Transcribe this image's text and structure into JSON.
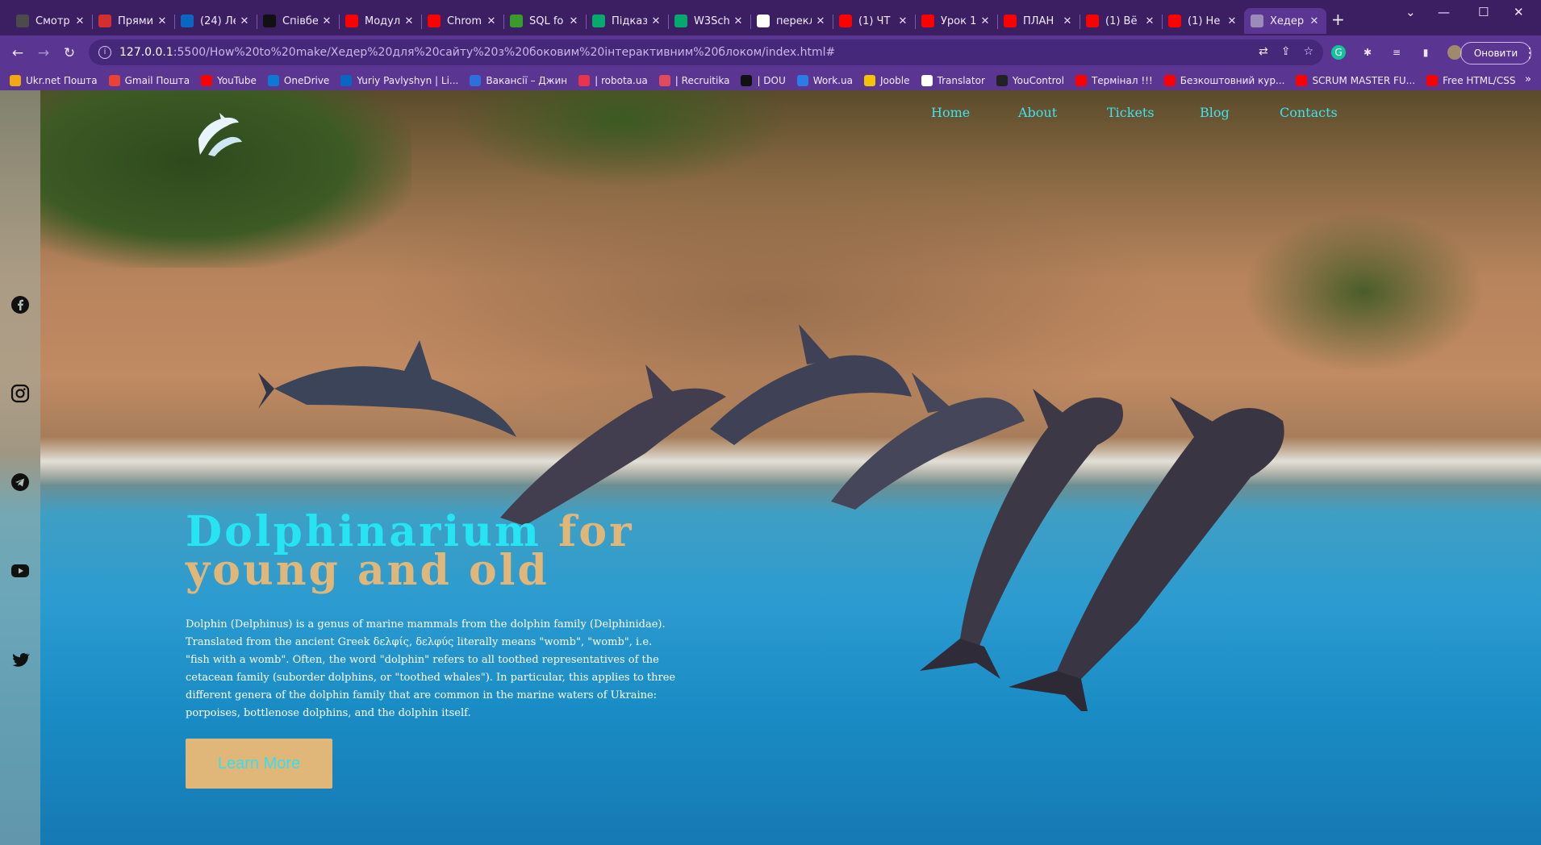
{
  "tabs": [
    {
      "label": "Смотр",
      "icon": "hdrezka-icon",
      "color": "#4b4b4b"
    },
    {
      "label": "Прями",
      "icon": "24-channel-icon",
      "color": "#d32f2f"
    },
    {
      "label": "(24) Ле",
      "icon": "linkedin-icon",
      "color": "#0a66c2"
    },
    {
      "label": "Співбе",
      "icon": "dou-icon",
      "color": "#111111"
    },
    {
      "label": "Модул",
      "icon": "youtube-icon",
      "color": "#ff0000"
    },
    {
      "label": "Chrom",
      "icon": "youtube-icon",
      "color": "#ff0000"
    },
    {
      "label": "SQL fo",
      "icon": "m-icon",
      "color": "#3a9b2d"
    },
    {
      "label": "Підказ",
      "icon": "w3schools-icon",
      "color": "#04aa6d"
    },
    {
      "label": "W3Sch",
      "icon": "w3schools-icon",
      "color": "#04aa6d"
    },
    {
      "label": "перекл",
      "icon": "google-icon",
      "color": "#ffffff"
    },
    {
      "label": "(1) ЧТ",
      "icon": "youtube-icon",
      "color": "#ff0000"
    },
    {
      "label": "Урок 1",
      "icon": "youtube-icon",
      "color": "#ff0000"
    },
    {
      "label": "ПЛАН",
      "icon": "youtube-icon",
      "color": "#ff0000"
    },
    {
      "label": "(1) Вё",
      "icon": "youtube-icon",
      "color": "#ff0000"
    },
    {
      "label": "(1) Не",
      "icon": "youtube-icon",
      "color": "#ff0000"
    },
    {
      "label": "Хедер",
      "icon": "globe-icon",
      "color": "#9a8bb8",
      "active": true
    }
  ],
  "address": {
    "host": "127.0.0.1",
    "path": ":5500/How%20to%20make/Хедер%20для%20сайту%20з%20боковим%20інтерактивним%20блоком/index.html#"
  },
  "update_label": "Оновити",
  "bookmarks": [
    {
      "label": "Ukr.net Пошта",
      "icon": "ukrnet-icon",
      "color": "#f3a712"
    },
    {
      "label": "Gmail Пошта",
      "icon": "gmail-icon",
      "color": "#ea4335"
    },
    {
      "label": "YouTube",
      "icon": "youtube-icon",
      "color": "#ff0000"
    },
    {
      "label": "OneDrive",
      "icon": "onedrive-icon",
      "color": "#0f78d4"
    },
    {
      "label": "Yuriy Pavlyshyn | Li...",
      "icon": "linkedin-icon",
      "color": "#0a66c2"
    },
    {
      "label": "Вакансії – Джин",
      "icon": "djinni-icon",
      "color": "#2d6fdb"
    },
    {
      "label": "| robota.ua",
      "icon": "robota-icon",
      "color": "#e8344e"
    },
    {
      "label": "| Recruitika",
      "icon": "recruitika-icon",
      "color": "#e24a5a"
    },
    {
      "label": "| DOU",
      "icon": "dou-icon",
      "color": "#111111"
    },
    {
      "label": "Work.ua",
      "icon": "workua-icon",
      "color": "#2d7be5"
    },
    {
      "label": "Jooble",
      "icon": "jooble-icon",
      "color": "#f4c400"
    },
    {
      "label": "Translator",
      "icon": "google-icon",
      "color": "#ffffff"
    },
    {
      "label": "YouControl",
      "icon": "youcontrol-icon",
      "color": "#222222"
    },
    {
      "label": "Термінал !!!",
      "icon": "youtube-icon",
      "color": "#ff0000"
    },
    {
      "label": "Безкоштовний кур...",
      "icon": "youtube-icon",
      "color": "#ff0000"
    },
    {
      "label": "SCRUM MASTER FU...",
      "icon": "youtube-icon",
      "color": "#ff0000"
    },
    {
      "label": "Free HTML/CSS",
      "icon": "youtube-icon",
      "color": "#ff0000"
    }
  ],
  "page": {
    "nav": [
      "Home",
      "About",
      "Tickets",
      "Blog",
      "Contacts"
    ],
    "hero_title_1": "Dolphinarium",
    "hero_title_2": "for",
    "hero_title_3": "young and old",
    "hero_desc": "Dolphin (Delphinus) is a genus of marine mammals from the dolphin family (Delphinidae). Translated from the ancient Greek δελφίς, δελφύς literally means \"womb\", \"womb\", i.e. \"fish with a womb\". Often, the word \"dolphin\" refers to all toothed representatives of the cetacean family (suborder dolphins, or \"toothed whales\"). In particular, this applies to three different genera of the dolphin family that are common in the marine waters of Ukraine: porpoises, bottlenose dolphins, and the dolphin itself.",
    "cta_label": "Learn More",
    "social": [
      "facebook-icon",
      "instagram-icon",
      "telegram-icon",
      "youtube-icon",
      "twitter-icon"
    ],
    "colors": {
      "accent_cyan": "#27e4f2",
      "accent_gold": "#e0b679"
    }
  }
}
